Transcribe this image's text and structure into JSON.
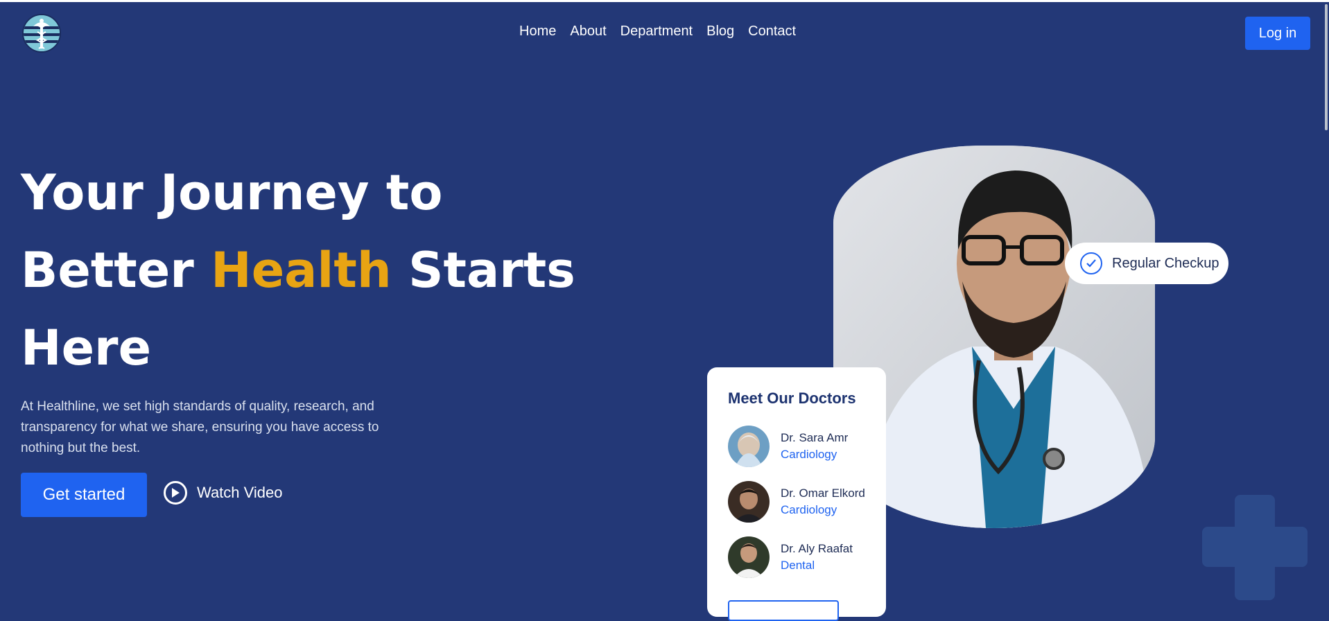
{
  "nav": {
    "items": [
      {
        "label": "Home"
      },
      {
        "label": "About"
      },
      {
        "label": "Department"
      },
      {
        "label": "Blog"
      },
      {
        "label": "Contact"
      }
    ],
    "login_label": "Log in"
  },
  "hero": {
    "title_line1": "Your Journey to",
    "title_line2_before": "Better ",
    "title_highlight": "Health",
    "title_line2_after": " Starts",
    "title_line3": "Here",
    "description": "At Healthline, we set high standards of quality, research, and transparency for what we share, ensuring you have access to nothing but the best.",
    "cta_primary": "Get started",
    "cta_secondary": "Watch Video"
  },
  "badge": {
    "label": "Regular Checkup"
  },
  "doctors_card": {
    "title": "Meet Our Doctors",
    "doctors": [
      {
        "name": "Dr. Sara Amr",
        "specialty": "Cardiology"
      },
      {
        "name": "Dr. Omar Elkord",
        "specialty": "Cardiology"
      },
      {
        "name": "Dr. Aly Raafat",
        "specialty": "Dental"
      }
    ]
  },
  "colors": {
    "background": "#233877",
    "accent": "#1f63f0",
    "highlight": "#e8a413"
  },
  "icons": [
    "caduceus-logo",
    "play-icon",
    "check-icon",
    "plus-icon"
  ]
}
